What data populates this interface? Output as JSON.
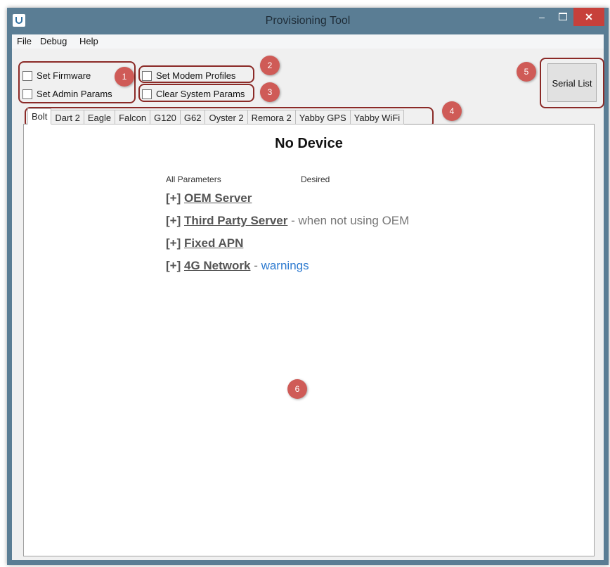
{
  "window": {
    "title": "Provisioning Tool",
    "minimize": "–",
    "close": "✕"
  },
  "menu": [
    "File",
    "Debug",
    "Help"
  ],
  "options": {
    "set_firmware": "Set Firmware",
    "set_admin_params": "Set Admin Params",
    "set_modem_profiles": "Set Modem Profiles",
    "clear_system_params": "Clear System Params"
  },
  "serial_list_label": "Serial List",
  "tabs": [
    "Bolt",
    "Dart 2",
    "Eagle",
    "Falcon",
    "G120",
    "G62",
    "Oyster 2",
    "Remora 2",
    "Yabby GPS",
    "Yabby WiFi"
  ],
  "content": {
    "device": "No Device",
    "col_all": "All Parameters",
    "col_desired": "Desired",
    "sections": [
      {
        "prefix": "[+]",
        "name": "OEM Server",
        "note": "",
        "link_note": ""
      },
      {
        "prefix": "[+]",
        "name": "Third Party Server",
        "note": " - when not using OEM",
        "link_note": ""
      },
      {
        "prefix": "[+]",
        "name": "Fixed APN",
        "note": "",
        "link_note": ""
      },
      {
        "prefix": "[+]",
        "name": "4G Network",
        "note": " - ",
        "link_note": "warnings"
      }
    ]
  },
  "annotations": [
    "1",
    "2",
    "3",
    "4",
    "5",
    "6"
  ],
  "colors": {
    "titlebar": "#5a7d94",
    "annotation": "#cf5b57",
    "close": "#c7403b",
    "link": "#2e7bd0"
  }
}
